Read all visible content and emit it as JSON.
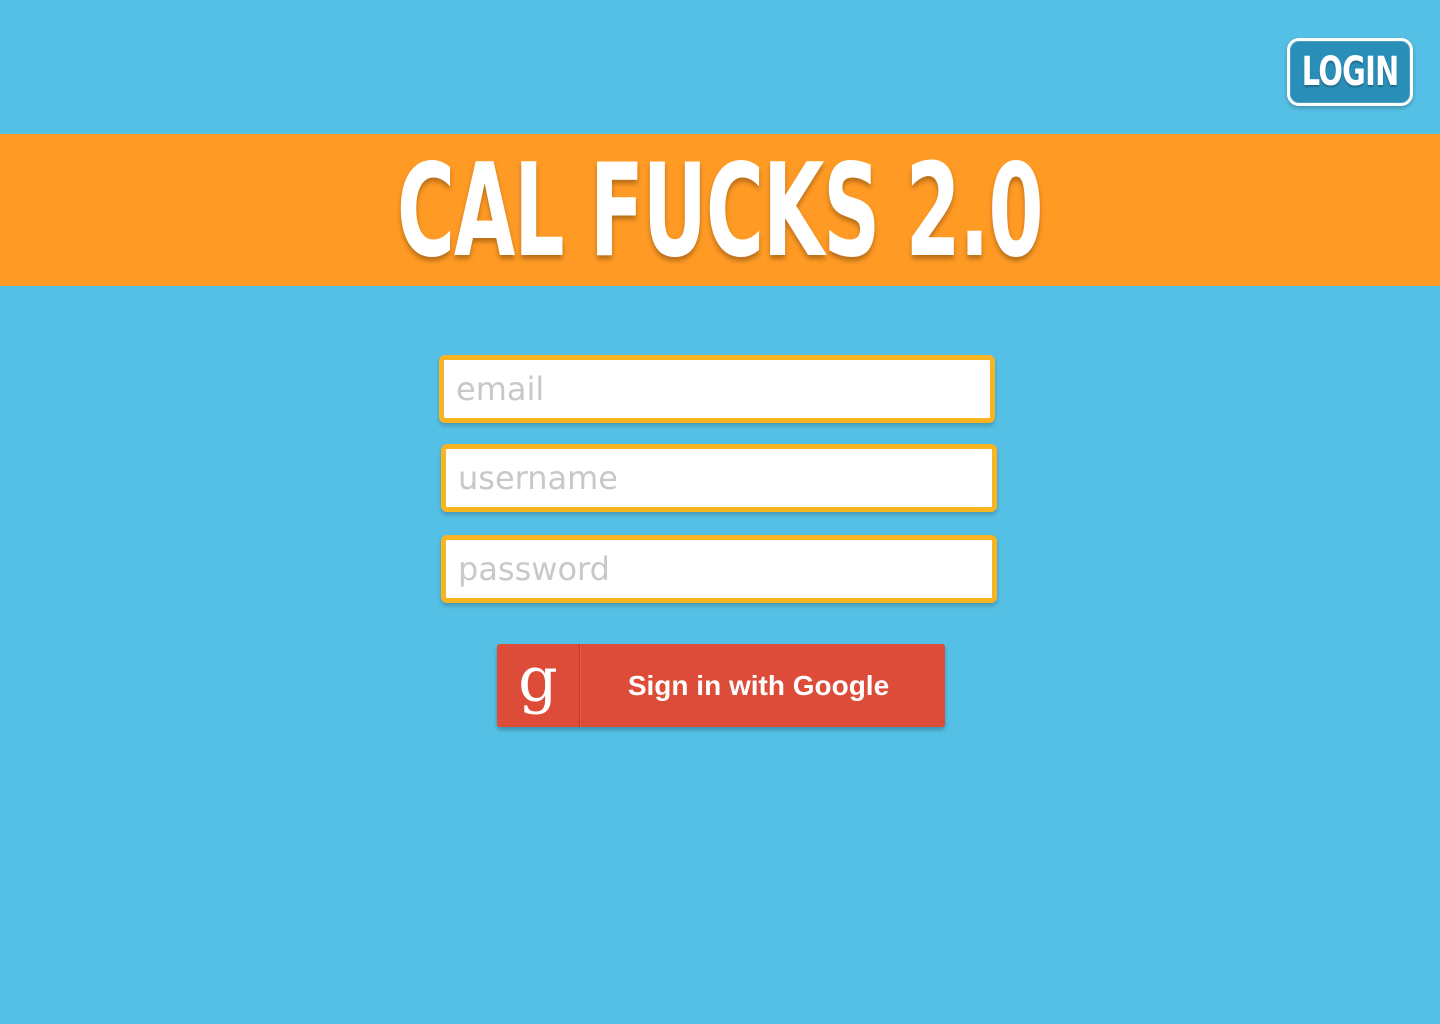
{
  "header": {
    "login_label": "LOGIN"
  },
  "banner": {
    "title": "CAL FUCKS 2.0"
  },
  "form": {
    "email_placeholder": "email",
    "username_placeholder": "username",
    "password_placeholder": "password"
  },
  "google_button": {
    "icon": "google-g-icon",
    "icon_glyph": "g",
    "label": "Sign in with Google"
  },
  "colors": {
    "background": "#55c0e5",
    "banner": "#ff9a24",
    "field_border": "#f9b521",
    "google_red": "#dd4b39"
  }
}
